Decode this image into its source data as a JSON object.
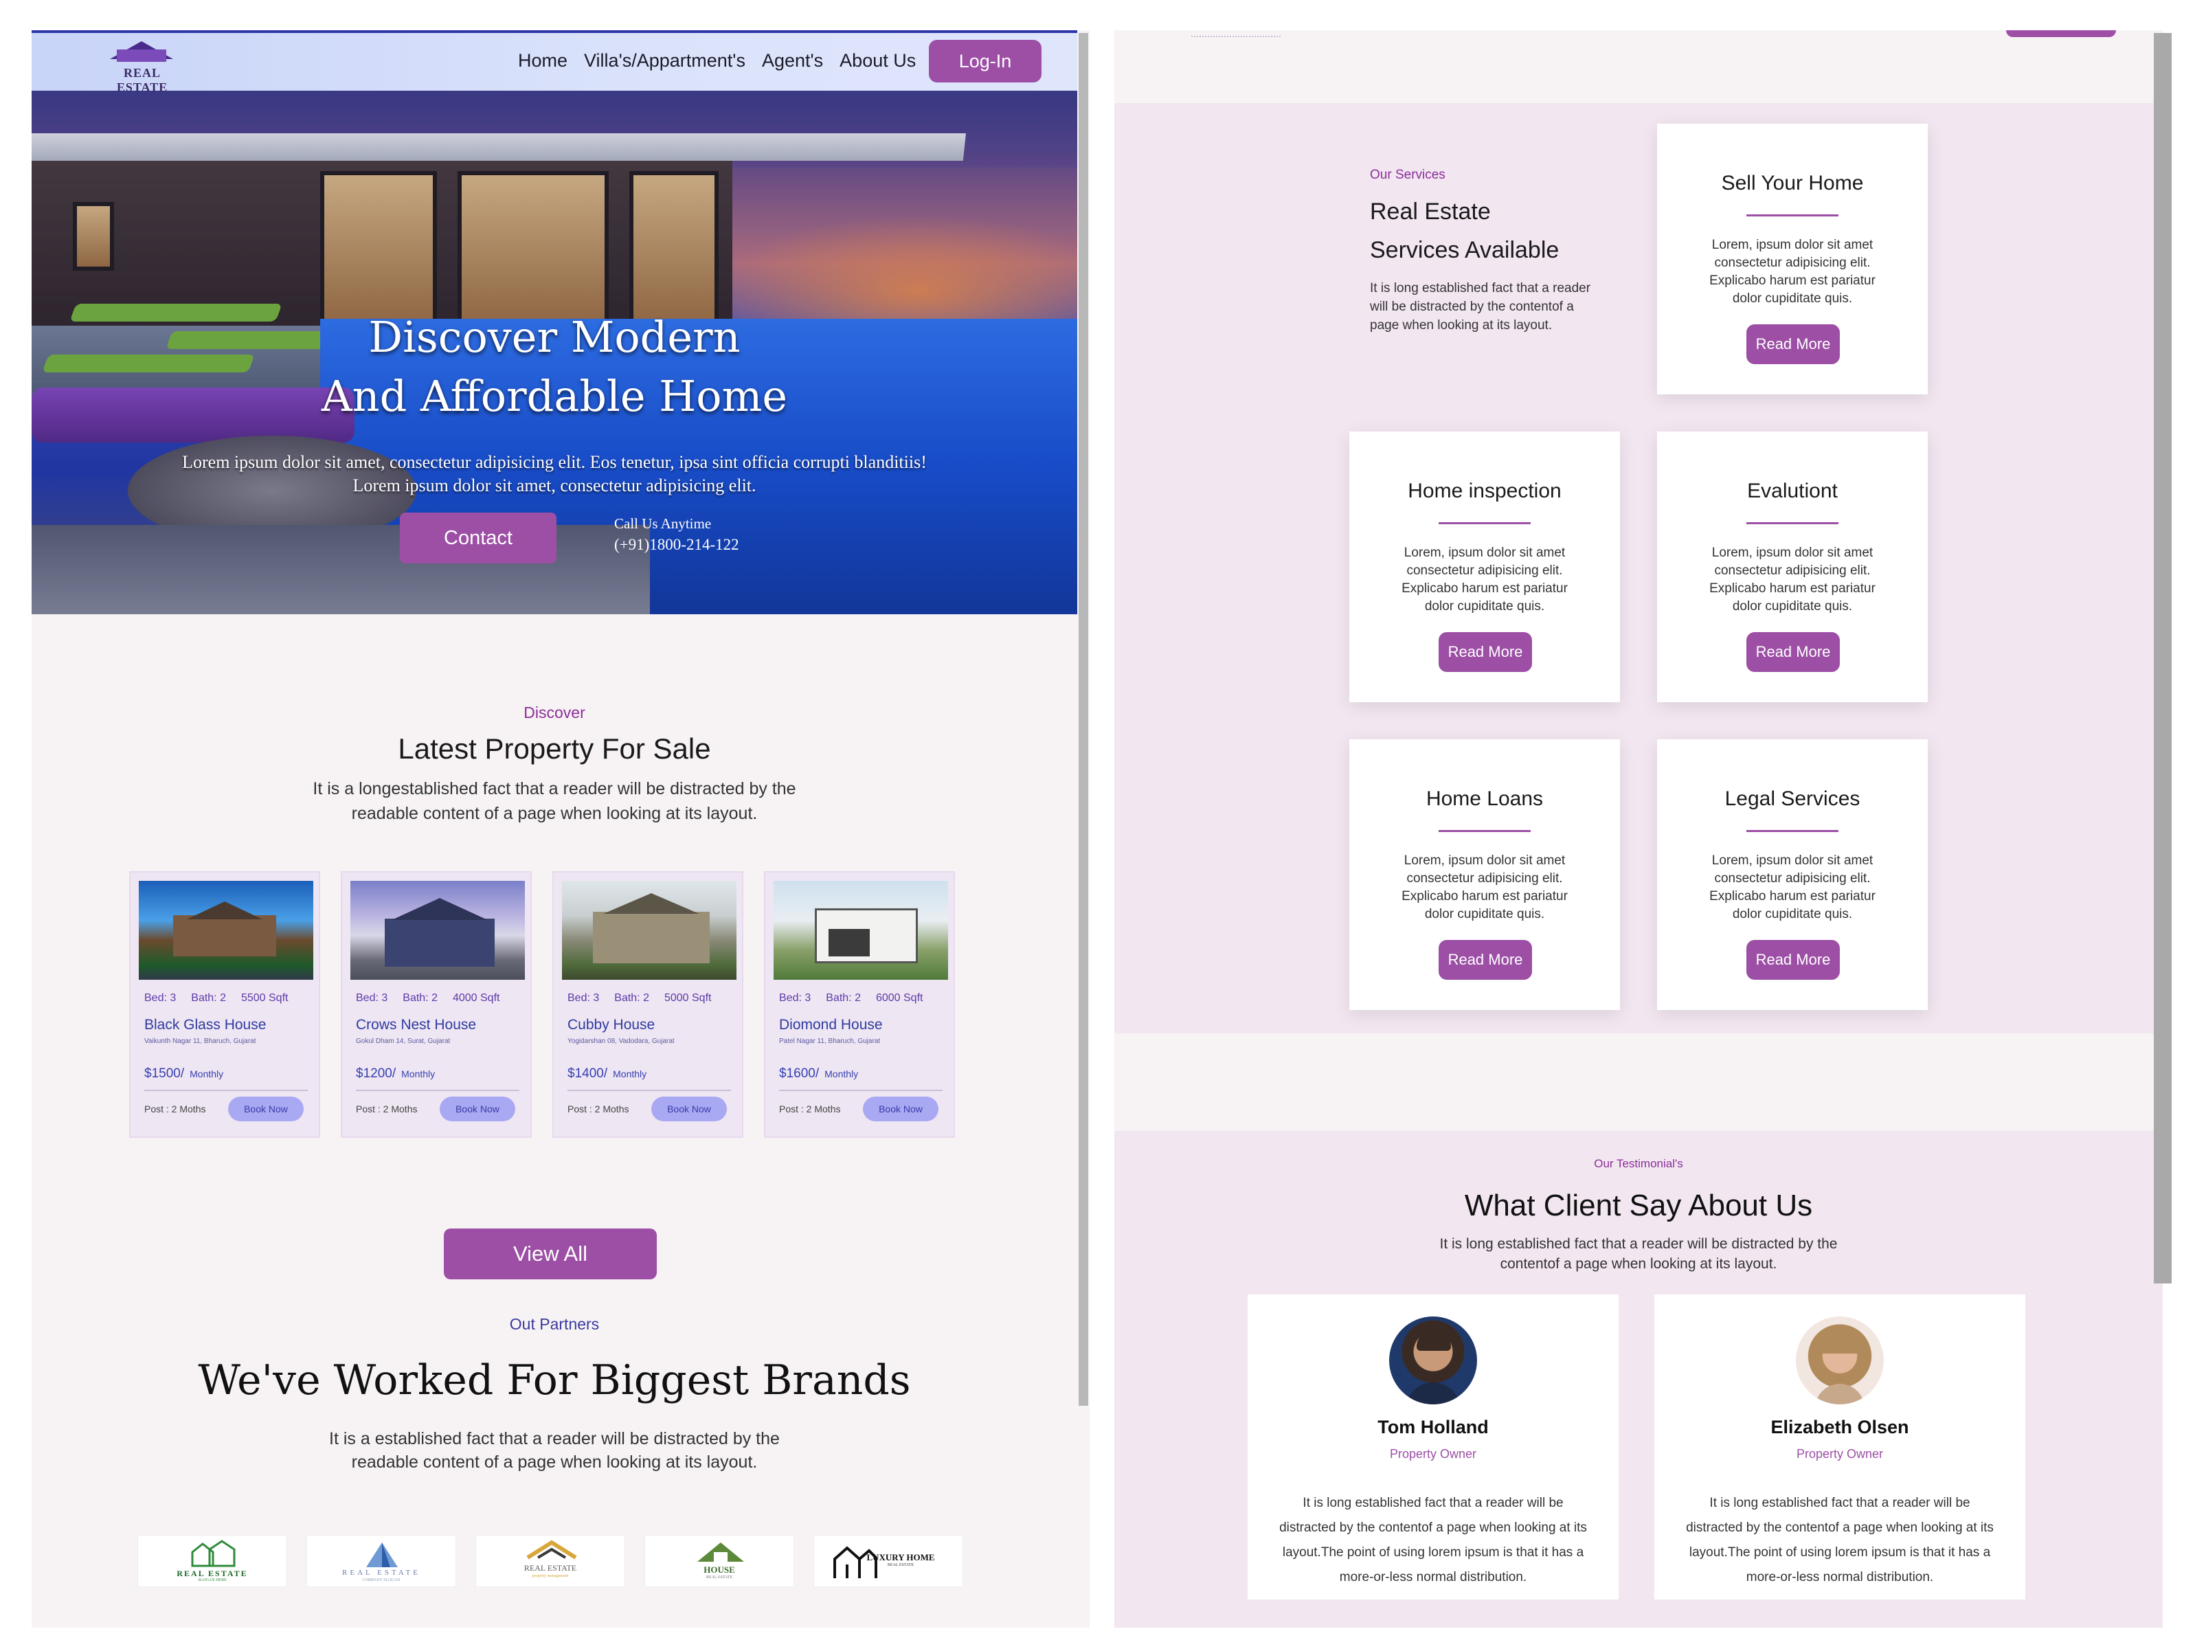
{
  "nav": {
    "logo_text": "REAL ESTATE",
    "links": [
      "Home",
      "Villa's/Appartment's",
      "Agent's",
      "About Us"
    ],
    "login_label": "Log-In"
  },
  "hero": {
    "title_line1": "Discover Modern",
    "title_line2": "And Affordable Home",
    "subtitle_line1": "Lorem ipsum dolor sit amet, consectetur adipisicing elit. Eos tenetur, ipsa sint officia corrupti blanditiis!",
    "subtitle_line2": "Lorem ipsum dolor sit amet, consectetur adipisicing elit.",
    "contact_label": "Contact",
    "call_label": "Call Us Anytime",
    "call_number": "(+91)1800-214-122"
  },
  "latest": {
    "eyebrow": "Discover",
    "title": "Latest Property For Sale",
    "para_line1": "It is a longestablished fact that a reader will be distracted by the",
    "para_line2": "readable content of a page when looking at its layout."
  },
  "properties": [
    {
      "bed": "Bed: 3",
      "bath": "Bath: 2",
      "sqft": "5500 Sqft",
      "name": "Black Glass House",
      "address": "Vaikunth Nagar 11, Bharuch, Gujarat",
      "price": "$1500/",
      "period": "Monthly",
      "post": "Post : 2 Moths",
      "book": "Book Now"
    },
    {
      "bed": "Bed: 3",
      "bath": "Bath: 2",
      "sqft": "4000 Sqft",
      "name": "Crows Nest House",
      "address": "Gokul Dham 14, Surat, Gujarat",
      "price": "$1200/",
      "period": "Monthly",
      "post": "Post : 2 Moths",
      "book": "Book Now"
    },
    {
      "bed": "Bed: 3",
      "bath": "Bath: 2",
      "sqft": "5000 Sqft",
      "name": "Cubby House",
      "address": "Yogidarshan 08, Vadodara, Gujarat",
      "price": "$1400/",
      "period": "Monthly",
      "post": "Post : 2 Moths",
      "book": "Book Now"
    },
    {
      "bed": "Bed: 3",
      "bath": "Bath: 2",
      "sqft": "6000 Sqft",
      "name": "Diomond House",
      "address": "Patel Nagar 11, Bharuch, Gujarat",
      "price": "$1600/",
      "period": "Monthly",
      "post": "Post : 2 Moths",
      "book": "Book Now"
    }
  ],
  "view_all_label": "View All",
  "partners": {
    "eyebrow": "Out Partners",
    "title": "We've Worked For Biggest Brands",
    "para_line1": "It is a established fact that a reader will be distracted by the",
    "para_line2": "readable content of a page when looking at its layout.",
    "logos": [
      {
        "main": "REAL ESTATE",
        "sub": "SLOGAN HERE"
      },
      {
        "main": "REAL ESTATE",
        "sub": "COMPANY SLOGAN"
      },
      {
        "main": "REAL ESTATE",
        "sub": "property management"
      },
      {
        "main": "HOUSE",
        "sub": "REAL ESTATE"
      },
      {
        "main": "LUXURY HOME",
        "sub": "REAL ESTATE"
      }
    ]
  },
  "services": {
    "eyebrow": "Our Services",
    "title_line1": "Real Estate",
    "title_line2": "Services Available",
    "para": "It is long established fact that a reader will be distracted by the contentof a page when looking at its layout.",
    "cards": [
      {
        "title": "Sell Your Home",
        "text": "Lorem, ipsum dolor sit amet consectetur adipisicing elit. Explicabo harum est pariatur dolor cupiditate quis.",
        "button": "Read More"
      },
      {
        "title": "Home inspection",
        "text": "Lorem, ipsum dolor sit amet consectetur adipisicing elit. Explicabo harum est pariatur dolor cupiditate quis.",
        "button": "Read More"
      },
      {
        "title": "Evalutiont",
        "text": "Lorem, ipsum dolor sit amet consectetur adipisicing elit. Explicabo harum est pariatur dolor cupiditate quis.",
        "button": "Read More"
      },
      {
        "title": "Home Loans",
        "text": "Lorem, ipsum dolor sit amet consectetur adipisicing elit. Explicabo harum est pariatur dolor cupiditate quis.",
        "button": "Read More"
      },
      {
        "title": "Legal Services",
        "text": "Lorem, ipsum dolor sit amet consectetur adipisicing elit. Explicabo harum est pariatur dolor cupiditate quis.",
        "button": "Read More"
      }
    ]
  },
  "testimonials": {
    "eyebrow": "Our Testimonial's",
    "title": "What Client Say About Us",
    "para_line1": "It is long established fact that a reader will be distracted by the",
    "para_line2": "contentof a page when looking at its layout.",
    "items": [
      {
        "name": "Tom Holland",
        "role": "Property Owner",
        "text": "It is long established fact that a reader will be distracted by the contentof a page when looking at its layout.The point of using lorem ipsum is that it has a more-or-less normal distribution."
      },
      {
        "name": "Elizabeth Olsen",
        "role": "Property Owner",
        "text": "It is long established fact that a reader will be distracted by the contentof a page when looking at its layout.The point of using lorem ipsum is that it has a more-or-less normal distribution."
      }
    ]
  },
  "colors": {
    "accent": "#9c4fa5",
    "accent_text": "#8b2e99",
    "link_blue": "#2e3ba0",
    "book_btn": "#a9a8f2",
    "services_bg": "#f2e6f1",
    "page_bg": "#f7f3f4"
  }
}
